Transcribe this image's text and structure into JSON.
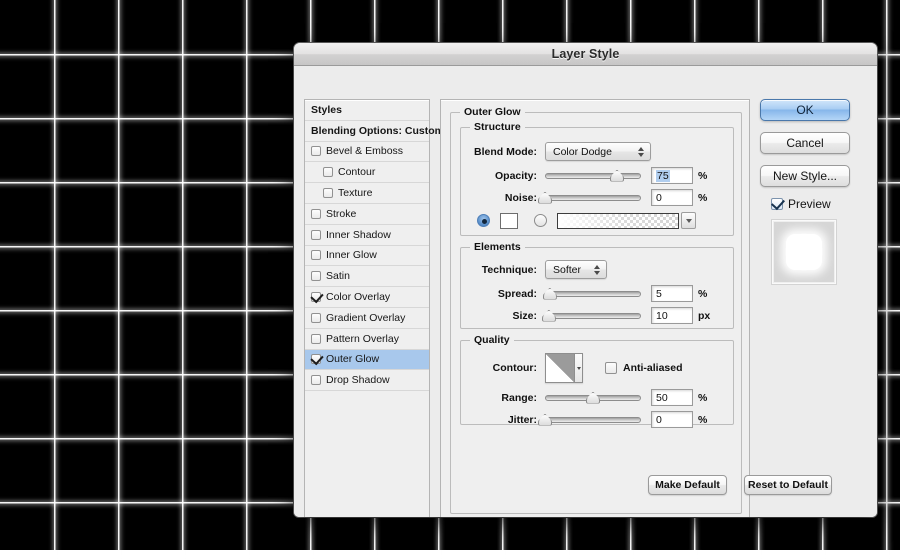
{
  "window": {
    "title": "Layer Style"
  },
  "styles_list": [
    {
      "label": "Styles",
      "kind": "header",
      "checkbox": false,
      "checked": false,
      "indent": false,
      "selected": false
    },
    {
      "label": "Blending Options: Custom",
      "kind": "header",
      "checkbox": false,
      "checked": false,
      "indent": false,
      "selected": false
    },
    {
      "label": "Bevel & Emboss",
      "kind": "effect",
      "checkbox": true,
      "checked": false,
      "indent": false,
      "selected": false
    },
    {
      "label": "Contour",
      "kind": "effect",
      "checkbox": true,
      "checked": false,
      "indent": true,
      "selected": false
    },
    {
      "label": "Texture",
      "kind": "effect",
      "checkbox": true,
      "checked": false,
      "indent": true,
      "selected": false
    },
    {
      "label": "Stroke",
      "kind": "effect",
      "checkbox": true,
      "checked": false,
      "indent": false,
      "selected": false
    },
    {
      "label": "Inner Shadow",
      "kind": "effect",
      "checkbox": true,
      "checked": false,
      "indent": false,
      "selected": false
    },
    {
      "label": "Inner Glow",
      "kind": "effect",
      "checkbox": true,
      "checked": false,
      "indent": false,
      "selected": false
    },
    {
      "label": "Satin",
      "kind": "effect",
      "checkbox": true,
      "checked": false,
      "indent": false,
      "selected": false
    },
    {
      "label": "Color Overlay",
      "kind": "effect",
      "checkbox": true,
      "checked": true,
      "indent": false,
      "selected": false
    },
    {
      "label": "Gradient Overlay",
      "kind": "effect",
      "checkbox": true,
      "checked": false,
      "indent": false,
      "selected": false
    },
    {
      "label": "Pattern Overlay",
      "kind": "effect",
      "checkbox": true,
      "checked": false,
      "indent": false,
      "selected": false
    },
    {
      "label": "Outer Glow",
      "kind": "effect",
      "checkbox": true,
      "checked": true,
      "indent": false,
      "selected": true
    },
    {
      "label": "Drop Shadow",
      "kind": "effect",
      "checkbox": true,
      "checked": false,
      "indent": false,
      "selected": false
    }
  ],
  "panel": {
    "title": "Outer Glow",
    "structure": {
      "legend": "Structure",
      "blend_mode_label": "Blend Mode:",
      "blend_mode_value": "Color Dodge",
      "opacity_label": "Opacity:",
      "opacity_value": "75",
      "opacity_unit": "%",
      "opacity_percent": 75,
      "noise_label": "Noise:",
      "noise_value": "0",
      "noise_unit": "%",
      "noise_percent": 0,
      "fill_type": "color",
      "color_swatch": "#ffffff"
    },
    "elements": {
      "legend": "Elements",
      "technique_label": "Technique:",
      "technique_value": "Softer",
      "spread_label": "Spread:",
      "spread_value": "5",
      "spread_unit": "%",
      "spread_percent": 5,
      "size_label": "Size:",
      "size_value": "10",
      "size_unit": "px",
      "size_percent": 4
    },
    "quality": {
      "legend": "Quality",
      "contour_label": "Contour:",
      "anti_aliased_label": "Anti-aliased",
      "anti_aliased_checked": false,
      "range_label": "Range:",
      "range_value": "50",
      "range_unit": "%",
      "range_percent": 50,
      "jitter_label": "Jitter:",
      "jitter_value": "0",
      "jitter_unit": "%",
      "jitter_percent": 0
    },
    "make_default_label": "Make Default",
    "reset_default_label": "Reset to Default"
  },
  "buttons": {
    "ok": "OK",
    "cancel": "Cancel",
    "new_style": "New Style...",
    "preview_label": "Preview",
    "preview_checked": true
  },
  "colors": {
    "selection_blue": "#a8c8ec",
    "primary_button": "#a9cdf3",
    "dialog_bg": "#ececec",
    "panel_bg": "#efefef",
    "backdrop": "#000000"
  }
}
